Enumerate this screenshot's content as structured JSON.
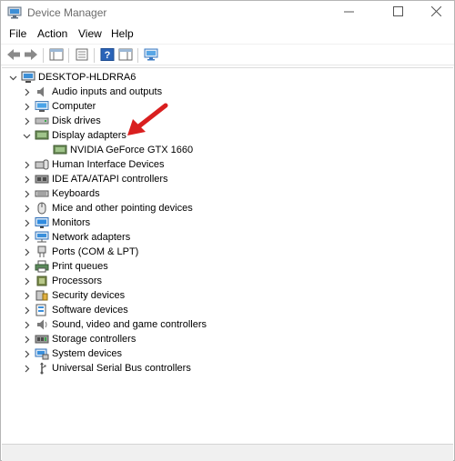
{
  "window": {
    "title": "Device Manager"
  },
  "menu": [
    "File",
    "Action",
    "View",
    "Help"
  ],
  "tree": {
    "root": "DESKTOP-HLDRRA6",
    "categories": [
      {
        "label": "Audio inputs and outputs",
        "icon": "speaker-icon"
      },
      {
        "label": "Computer",
        "icon": "computer-icon"
      },
      {
        "label": "Disk drives",
        "icon": "disk-drive-icon"
      },
      {
        "label": "Display adapters",
        "icon": "display-adapter-icon",
        "expanded": true
      },
      {
        "label": "NVIDIA GeForce GTX 1660",
        "icon": "display-adapter-icon",
        "child": true
      },
      {
        "label": "Human Interface Devices",
        "icon": "hid-icon"
      },
      {
        "label": "IDE ATA/ATAPI controllers",
        "icon": "ide-controller-icon"
      },
      {
        "label": "Keyboards",
        "icon": "keyboard-icon"
      },
      {
        "label": "Mice and other pointing devices",
        "icon": "mouse-icon"
      },
      {
        "label": "Monitors",
        "icon": "monitor-icon"
      },
      {
        "label": "Network adapters",
        "icon": "network-adapter-icon"
      },
      {
        "label": "Ports (COM & LPT)",
        "icon": "port-icon"
      },
      {
        "label": "Print queues",
        "icon": "printer-icon"
      },
      {
        "label": "Processors",
        "icon": "processor-icon"
      },
      {
        "label": "Security devices",
        "icon": "security-device-icon"
      },
      {
        "label": "Software devices",
        "icon": "software-device-icon"
      },
      {
        "label": "Sound, video and game controllers",
        "icon": "sound-controller-icon"
      },
      {
        "label": "Storage controllers",
        "icon": "storage-controller-icon"
      },
      {
        "label": "System devices",
        "icon": "system-device-icon"
      },
      {
        "label": "Universal Serial Bus controllers",
        "icon": "usb-icon"
      }
    ]
  },
  "colors": {
    "annotation_arrow": "#d91f1f",
    "accent": "#1a73c9"
  }
}
